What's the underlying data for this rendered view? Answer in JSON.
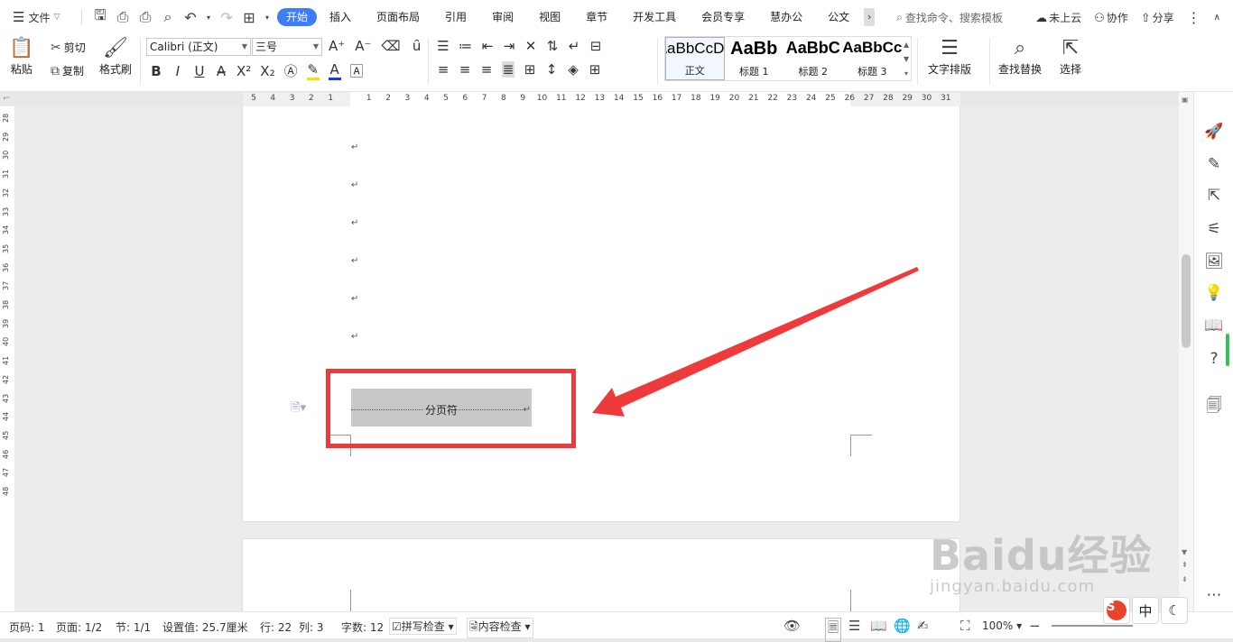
{
  "menubar": {
    "file_label": "文件",
    "tabs": [
      "开始",
      "插入",
      "页面布局",
      "引用",
      "审阅",
      "视图",
      "章节",
      "开发工具",
      "会员专享",
      "慧办公",
      "公文"
    ],
    "search_placeholder": "查找命令、搜索模板",
    "cloud_label": "未上云",
    "collab_label": "协作",
    "share_label": "分享"
  },
  "ribbon": {
    "paste_label": "粘贴",
    "cut_label": "剪切",
    "copy_label": "复制",
    "format_painter_label": "格式刷",
    "font_name": "Calibri (正文)",
    "font_size": "三号",
    "styles": [
      {
        "sample": "AaBbCcDd",
        "label": "正文"
      },
      {
        "sample": "AaBb",
        "label": "标题 1"
      },
      {
        "sample": "AaBbC",
        "label": "标题 2"
      },
      {
        "sample": "AaBbCc",
        "label": "标题 3"
      }
    ],
    "text_layout_label": "文字排版",
    "find_replace_label": "查找替换",
    "select_label": "选择"
  },
  "hruler_ticks": [
    "5",
    "4",
    "3",
    "2",
    "1",
    "",
    "1",
    "2",
    "3",
    "4",
    "5",
    "6",
    "7",
    "8",
    "9",
    "10",
    "11",
    "12",
    "13",
    "14",
    "15",
    "16",
    "17",
    "18",
    "19",
    "20",
    "21",
    "22",
    "23",
    "24",
    "25",
    "26",
    "27",
    "28",
    "29",
    "30",
    "31"
  ],
  "vruler_ticks": [
    "28",
    "29",
    "30",
    "31",
    "32",
    "33",
    "34",
    "35",
    "36",
    "37",
    "38",
    "39",
    "40",
    "41",
    "42",
    "43",
    "44",
    "45",
    "46",
    "47",
    "48"
  ],
  "document": {
    "paragraph_mark": "↵",
    "page_break_label": "分页符"
  },
  "statusbar": {
    "page_num": "页码: 1",
    "pages": "页面: 1/2",
    "section": "节: 1/1",
    "setting": "设置值: 25.7厘米",
    "line": "行: 22",
    "col": "列: 3",
    "word_count": "字数: 12",
    "spell_check": "拼写检查",
    "content_check": "内容检查",
    "zoom": "100%"
  },
  "ime": {
    "logo": "S",
    "lang": "中"
  },
  "watermark": {
    "brand": "Baidu经验",
    "url": "jingyan.baidu.com"
  },
  "colors": {
    "accent": "#3d7df5",
    "highlight_box": "#ee3a3a",
    "arrow": "#ee3a3a",
    "page_break_bg": "#c8c8c8"
  }
}
